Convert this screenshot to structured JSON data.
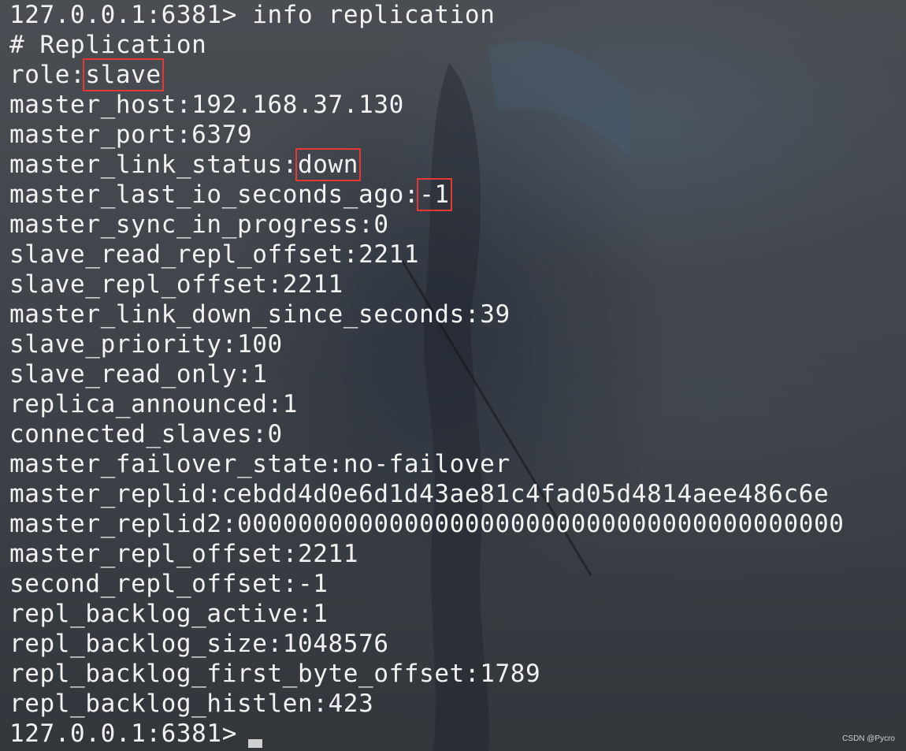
{
  "terminal": {
    "prompt": "127.0.0.1:6381>",
    "command": "info replication",
    "section_header": "# Replication",
    "fields": [
      {
        "key": "role",
        "value": "slave",
        "highlighted": true
      },
      {
        "key": "master_host",
        "value": "192.168.37.130"
      },
      {
        "key": "master_port",
        "value": "6379"
      },
      {
        "key": "master_link_status",
        "value": "down",
        "highlighted": true
      },
      {
        "key": "master_last_io_seconds_ago",
        "value": "-1",
        "highlighted": true
      },
      {
        "key": "master_sync_in_progress",
        "value": "0"
      },
      {
        "key": "slave_read_repl_offset",
        "value": "2211"
      },
      {
        "key": "slave_repl_offset",
        "value": "2211"
      },
      {
        "key": "master_link_down_since_seconds",
        "value": "39"
      },
      {
        "key": "slave_priority",
        "value": "100"
      },
      {
        "key": "slave_read_only",
        "value": "1"
      },
      {
        "key": "replica_announced",
        "value": "1"
      },
      {
        "key": "connected_slaves",
        "value": "0"
      },
      {
        "key": "master_failover_state",
        "value": "no-failover"
      },
      {
        "key": "master_replid",
        "value": "cebdd4d0e6d1d43ae81c4fad05d4814aee486c6e"
      },
      {
        "key": "master_replid2",
        "value": "0000000000000000000000000000000000000000"
      },
      {
        "key": "master_repl_offset",
        "value": "2211"
      },
      {
        "key": "second_repl_offset",
        "value": "-1"
      },
      {
        "key": "repl_backlog_active",
        "value": "1"
      },
      {
        "key": "repl_backlog_size",
        "value": "1048576"
      },
      {
        "key": "repl_backlog_first_byte_offset",
        "value": "1789"
      },
      {
        "key": "repl_backlog_histlen",
        "value": "423"
      }
    ],
    "final_prompt": "127.0.0.1:6381>"
  },
  "watermark": "CSDN @Pycro",
  "colors": {
    "text": "#f2f2f2",
    "highlight_box": "#e53935",
    "background": "#3c4148",
    "cursor": "#cfcfcf"
  }
}
